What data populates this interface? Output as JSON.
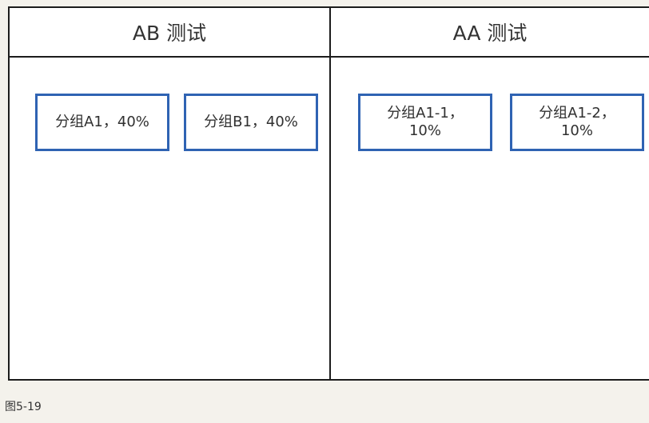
{
  "diagram": {
    "columns": [
      {
        "title": "AB 测试",
        "groups": [
          "分组A1，40%",
          "分组B1，40%"
        ]
      },
      {
        "title": "AA 测试",
        "groups": [
          "分组A1-1，\n10%",
          "分组A1-2，\n10%"
        ]
      }
    ],
    "border_color": "#1c1c1c",
    "group_border_color": "#2f63b3"
  },
  "caption": "图5-19"
}
